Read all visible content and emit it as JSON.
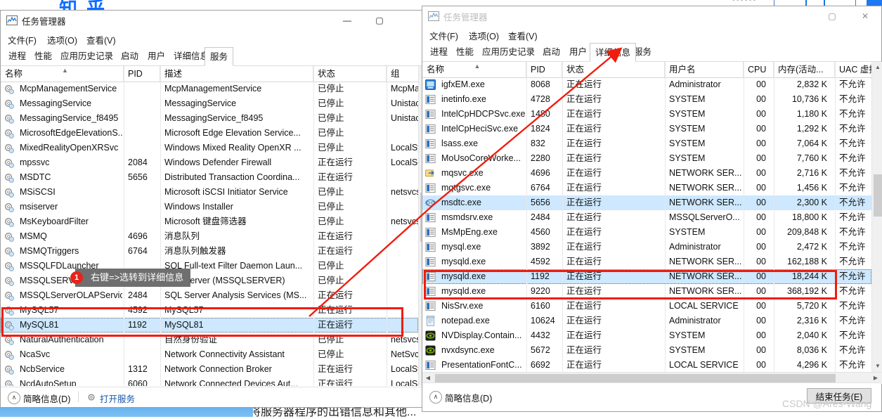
{
  "background": {
    "logo_text": "知 乎",
    "bottom_text": "家时，它会将服务器程序的出错信息和其他...",
    "topright_dots": "▪▪▪▪▪▪"
  },
  "left_window": {
    "title": "任务管理器",
    "icon": "task-manager-icon",
    "window_buttons": {
      "minimize": "—",
      "maximize": "▢"
    },
    "menu": [
      "文件(F)",
      "选项(O)",
      "查看(V)"
    ],
    "tabs": [
      "进程",
      "性能",
      "应用历史记录",
      "启动",
      "用户",
      "详细信息",
      "服务"
    ],
    "active_tab": "服务",
    "columns": [
      "名称",
      "PID",
      "描述",
      "状态",
      "组"
    ],
    "rows": [
      {
        "name": "McpManagementService",
        "pid": "",
        "desc": "McpManagementService",
        "status": "已停止",
        "group": "McpMan",
        "icon": "service-gear-icon"
      },
      {
        "name": "MessagingService",
        "pid": "",
        "desc": "MessagingService",
        "status": "已停止",
        "group": "Unistacks",
        "icon": "service-gear-icon"
      },
      {
        "name": "MessagingService_f8495",
        "pid": "",
        "desc": "MessagingService_f8495",
        "status": "已停止",
        "group": "Unistacks",
        "icon": "service-gear-icon"
      },
      {
        "name": "MicrosoftEdgeElevationS...",
        "pid": "",
        "desc": "Microsoft Edge Elevation Service...",
        "status": "已停止",
        "group": "",
        "icon": "service-gear-icon"
      },
      {
        "name": "MixedRealityOpenXRSvc",
        "pid": "",
        "desc": "Windows Mixed Reality OpenXR ...",
        "status": "已停止",
        "group": "LocalSyst",
        "icon": "service-gear-icon"
      },
      {
        "name": "mpssvc",
        "pid": "2084",
        "desc": "Windows Defender Firewall",
        "status": "正在运行",
        "group": "LocalSer",
        "icon": "service-gear-icon"
      },
      {
        "name": "MSDTC",
        "pid": "5656",
        "desc": "Distributed Transaction Coordina...",
        "status": "正在运行",
        "group": "",
        "icon": "service-gear-icon"
      },
      {
        "name": "MSiSCSI",
        "pid": "",
        "desc": "Microsoft iSCSI Initiator Service",
        "status": "已停止",
        "group": "netsvcs",
        "icon": "service-gear-icon"
      },
      {
        "name": "msiserver",
        "pid": "",
        "desc": "Windows Installer",
        "status": "已停止",
        "group": "",
        "icon": "service-gear-icon"
      },
      {
        "name": "MsKeyboardFilter",
        "pid": "",
        "desc": "Microsoft 键盘筛选器",
        "status": "已停止",
        "group": "netsvcs",
        "icon": "service-gear-icon"
      },
      {
        "name": "MSMQ",
        "pid": "4696",
        "desc": "消息队列",
        "status": "正在运行",
        "group": "",
        "icon": "service-gear-icon"
      },
      {
        "name": "MSMQTriggers",
        "pid": "6764",
        "desc": "消息队列触发器",
        "status": "正在运行",
        "group": "",
        "icon": "service-gear-icon"
      },
      {
        "name": "MSSQLFDLauncher",
        "pid": "",
        "desc": "SQL Full-text Filter Daemon Laun...",
        "status": "已停止",
        "group": "",
        "icon": "service-gear-icon"
      },
      {
        "name": "MSSQLSERVER",
        "pid": "",
        "desc": "SQL Server (MSSQLSERVER)",
        "status": "已停止",
        "group": "",
        "icon": "service-gear-icon"
      },
      {
        "name": "MSSQLServerOLAPService",
        "pid": "2484",
        "desc": "SQL Server Analysis Services (MS...",
        "status": "正在运行",
        "group": "",
        "icon": "service-gear-icon"
      },
      {
        "name": "MySQL57",
        "pid": "4592",
        "desc": "MySQL57",
        "status": "正在运行",
        "group": "",
        "icon": "service-gear-icon",
        "highlight": true
      },
      {
        "name": "MySQL81",
        "pid": "1192",
        "desc": "MySQL81",
        "status": "正在运行",
        "group": "",
        "icon": "service-gear-icon",
        "selected": true,
        "highlight": true
      },
      {
        "name": "NaturalAuthentication",
        "pid": "",
        "desc": "自然身份验证",
        "status": "已停止",
        "group": "netsvcs",
        "icon": "service-gear-icon"
      },
      {
        "name": "NcaSvc",
        "pid": "",
        "desc": "Network Connectivity Assistant",
        "status": "已停止",
        "group": "NetSvcs",
        "icon": "service-gear-icon"
      },
      {
        "name": "NcbService",
        "pid": "1312",
        "desc": "Network Connection Broker",
        "status": "正在运行",
        "group": "LocalSyst",
        "icon": "service-gear-icon"
      },
      {
        "name": "NcdAutoSetup",
        "pid": "6060",
        "desc": "Network Connected Devices Aut...",
        "status": "正在运行",
        "group": "LocalSer",
        "icon": "service-gear-icon"
      }
    ],
    "status": {
      "summary": "简略信息(D)",
      "link": "打开服务",
      "link_icon": "services-gear-icon"
    }
  },
  "right_window": {
    "title": "任务管理器",
    "icon": "task-manager-icon",
    "window_buttons": {
      "maximize": "▢",
      "close": "✕"
    },
    "menu": [
      "文件(F)",
      "选项(O)",
      "查看(V)"
    ],
    "tabs": [
      "进程",
      "性能",
      "应用历史记录",
      "启动",
      "用户",
      "详细信息",
      "服务"
    ],
    "active_tab": "详细信息",
    "columns": [
      "名称",
      "PID",
      "状态",
      "用户名",
      "CPU",
      "内存(活动...",
      "UAC 虚拟化"
    ],
    "rows": [
      {
        "name": "igfxEM.exe",
        "pid": "8068",
        "status": "正在运行",
        "user": "Administrator",
        "cpu": "00",
        "mem": "2,832 K",
        "uac": "不允许",
        "icon": "app-blue-icon"
      },
      {
        "name": "inetinfo.exe",
        "pid": "4728",
        "status": "正在运行",
        "user": "SYSTEM",
        "cpu": "00",
        "mem": "10,736 K",
        "uac": "不允许",
        "icon": "exe-icon"
      },
      {
        "name": "IntelCpHDCPSvc.exe",
        "pid": "1480",
        "status": "正在运行",
        "user": "SYSTEM",
        "cpu": "00",
        "mem": "1,180 K",
        "uac": "不允许",
        "icon": "exe-icon"
      },
      {
        "name": "IntelCpHeciSvc.exe",
        "pid": "1824",
        "status": "正在运行",
        "user": "SYSTEM",
        "cpu": "00",
        "mem": "1,292 K",
        "uac": "不允许",
        "icon": "exe-icon"
      },
      {
        "name": "lsass.exe",
        "pid": "832",
        "status": "正在运行",
        "user": "SYSTEM",
        "cpu": "00",
        "mem": "7,064 K",
        "uac": "不允许",
        "icon": "exe-icon"
      },
      {
        "name": "MoUsoCoreWorke...",
        "pid": "2280",
        "status": "正在运行",
        "user": "SYSTEM",
        "cpu": "00",
        "mem": "7,760 K",
        "uac": "不允许",
        "icon": "exe-icon"
      },
      {
        "name": "mqsvc.exe",
        "pid": "4696",
        "status": "正在运行",
        "user": "NETWORK SER...",
        "cpu": "00",
        "mem": "2,716 K",
        "uac": "不允许",
        "icon": "mq-icon"
      },
      {
        "name": "mqtgsvc.exe",
        "pid": "6764",
        "status": "正在运行",
        "user": "NETWORK SER...",
        "cpu": "00",
        "mem": "1,456 K",
        "uac": "不允许",
        "icon": "exe-icon"
      },
      {
        "name": "msdtc.exe",
        "pid": "5656",
        "status": "正在运行",
        "user": "NETWORK SER...",
        "cpu": "00",
        "mem": "2,300 K",
        "uac": "不允许",
        "icon": "msdtc-icon",
        "selected": true
      },
      {
        "name": "msmdsrv.exe",
        "pid": "2484",
        "status": "正在运行",
        "user": "MSSQLServerO...",
        "cpu": "00",
        "mem": "18,800 K",
        "uac": "不允许",
        "icon": "exe-icon"
      },
      {
        "name": "MsMpEng.exe",
        "pid": "4560",
        "status": "正在运行",
        "user": "SYSTEM",
        "cpu": "00",
        "mem": "209,848 K",
        "uac": "不允许",
        "icon": "exe-icon"
      },
      {
        "name": "mysql.exe",
        "pid": "3892",
        "status": "正在运行",
        "user": "Administrator",
        "cpu": "00",
        "mem": "2,472 K",
        "uac": "不允许",
        "icon": "exe-icon"
      },
      {
        "name": "mysqld.exe",
        "pid": "4592",
        "status": "正在运行",
        "user": "NETWORK SER...",
        "cpu": "00",
        "mem": "162,188 K",
        "uac": "不允许",
        "icon": "exe-icon",
        "highlight": true
      },
      {
        "name": "mysqld.exe",
        "pid": "1192",
        "status": "正在运行",
        "user": "NETWORK SER...",
        "cpu": "00",
        "mem": "18,244 K",
        "uac": "不允许",
        "icon": "exe-icon",
        "selected": true,
        "highlight": true
      },
      {
        "name": "mysqld.exe",
        "pid": "9220",
        "status": "正在运行",
        "user": "NETWORK SER...",
        "cpu": "00",
        "mem": "368,192 K",
        "uac": "不允许",
        "icon": "exe-icon"
      },
      {
        "name": "NisSrv.exe",
        "pid": "6160",
        "status": "正在运行",
        "user": "LOCAL SERVICE",
        "cpu": "00",
        "mem": "5,720 K",
        "uac": "不允许",
        "icon": "exe-icon"
      },
      {
        "name": "notepad.exe",
        "pid": "10624",
        "status": "正在运行",
        "user": "Administrator",
        "cpu": "00",
        "mem": "2,316 K",
        "uac": "不允许",
        "icon": "notepad-icon"
      },
      {
        "name": "NVDisplay.Contain...",
        "pid": "4432",
        "status": "正在运行",
        "user": "SYSTEM",
        "cpu": "00",
        "mem": "2,040 K",
        "uac": "不允许",
        "icon": "nvidia-icon"
      },
      {
        "name": "nvxdsync.exe",
        "pid": "5672",
        "status": "正在运行",
        "user": "SYSTEM",
        "cpu": "00",
        "mem": "8,036 K",
        "uac": "不允许",
        "icon": "nvidia-icon"
      },
      {
        "name": "PresentationFontC...",
        "pid": "6692",
        "status": "正在运行",
        "user": "LOCAL SERVICE",
        "cpu": "00",
        "mem": "4,296 K",
        "uac": "不允许",
        "icon": "exe-icon"
      }
    ],
    "status": {
      "summary": "简略信息(D)",
      "end_task_button": "结束任务(E)"
    }
  },
  "annotations": {
    "callout_1": {
      "badge": "1",
      "text": "右键=>选转到详细信息"
    },
    "red_color": "#f01c0e"
  },
  "watermark": "CSDN @Ares-Wang"
}
